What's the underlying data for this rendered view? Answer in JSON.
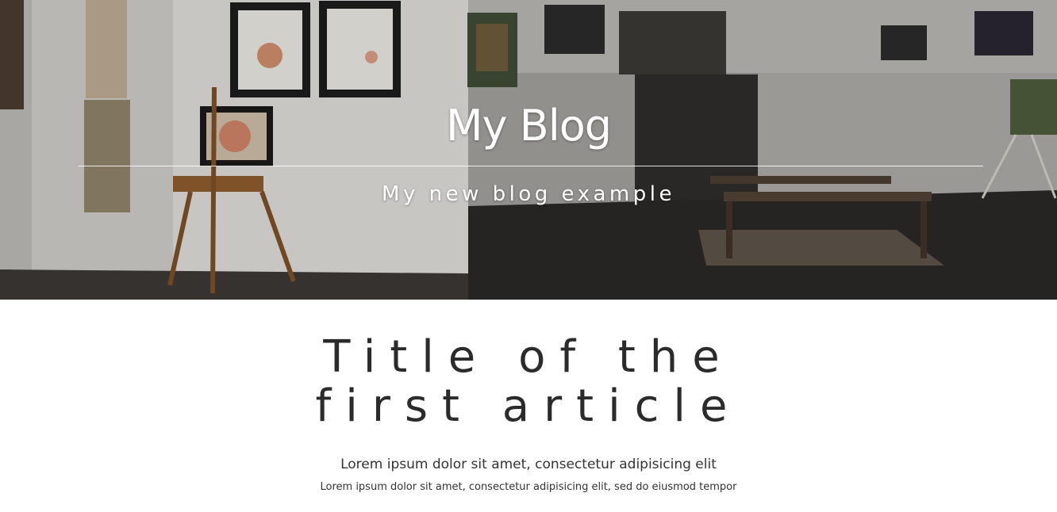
{
  "header": {
    "title": "My Blog",
    "subtitle": "My new blog example",
    "background_image": "art-gallery-interior-photo"
  },
  "articles": [
    {
      "title": "Title of the first article",
      "lead": "Lorem ipsum dolor sit amet, consectetur adipisicing elit",
      "excerpt": "Lorem ipsum dolor sit amet, consectetur adipisicing elit, sed do eiusmod tempor"
    }
  ],
  "colors": {
    "hero_text": "#ffffff",
    "body_text": "#2b2b2b",
    "page_background": "#ffffff"
  }
}
